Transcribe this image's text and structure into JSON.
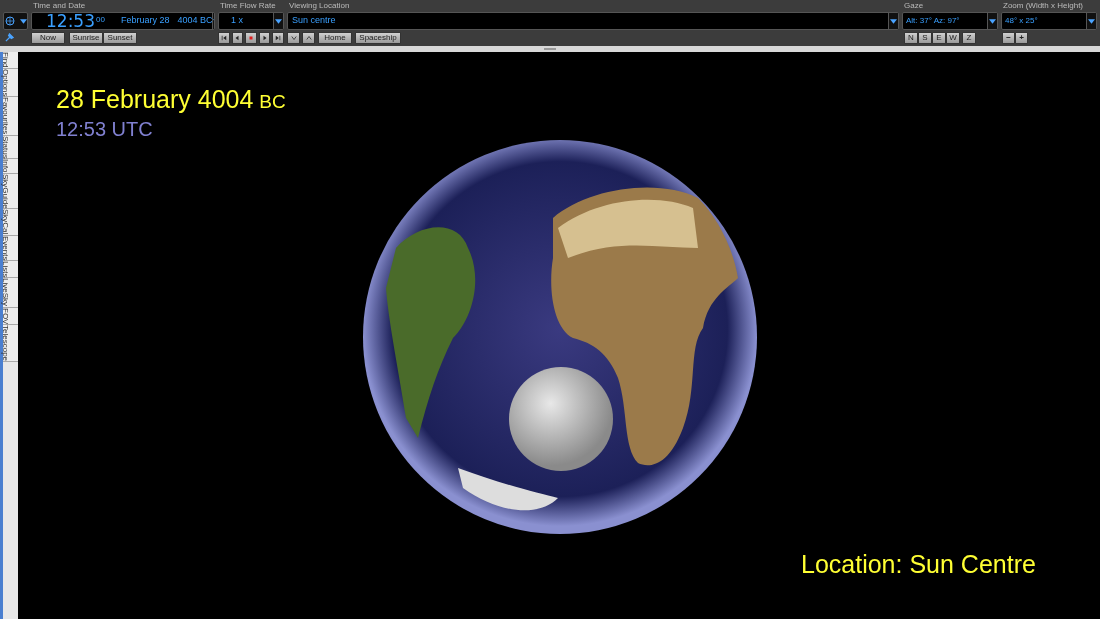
{
  "toolbar": {
    "time_and_date": {
      "label": "Time and Date",
      "time": "12:53",
      "seconds": "00",
      "date": "February 28",
      "year": "4004 BC",
      "buttons": [
        "Now",
        "Sunrise",
        "Sunset"
      ]
    },
    "time_flow_rate": {
      "label": "Time Flow Rate",
      "value": "1 x"
    },
    "viewing_location": {
      "label": "Viewing Location",
      "value": "Sun centre",
      "buttons": [
        "Home",
        "Spaceship"
      ]
    },
    "gaze": {
      "label": "Gaze",
      "value": "Alt: 37° Az: 97°",
      "buttons": [
        "N",
        "S",
        "E",
        "W",
        "Z"
      ]
    },
    "zoom": {
      "label": "Zoom (Width x Height)",
      "value": "48° x 25°",
      "buttons": [
        "−",
        "+"
      ]
    }
  },
  "side_tabs": [
    "Find",
    "Options",
    "Favourites",
    "Status",
    "Info",
    "SkyGuide",
    "SkyCal",
    "Events",
    "Lists",
    "LiveSky",
    "FOV",
    "Telescope"
  ],
  "overlay": {
    "date": "28 February 4004",
    "era": "BC",
    "time": "12:53 UTC",
    "location": "Location: Sun Centre"
  }
}
